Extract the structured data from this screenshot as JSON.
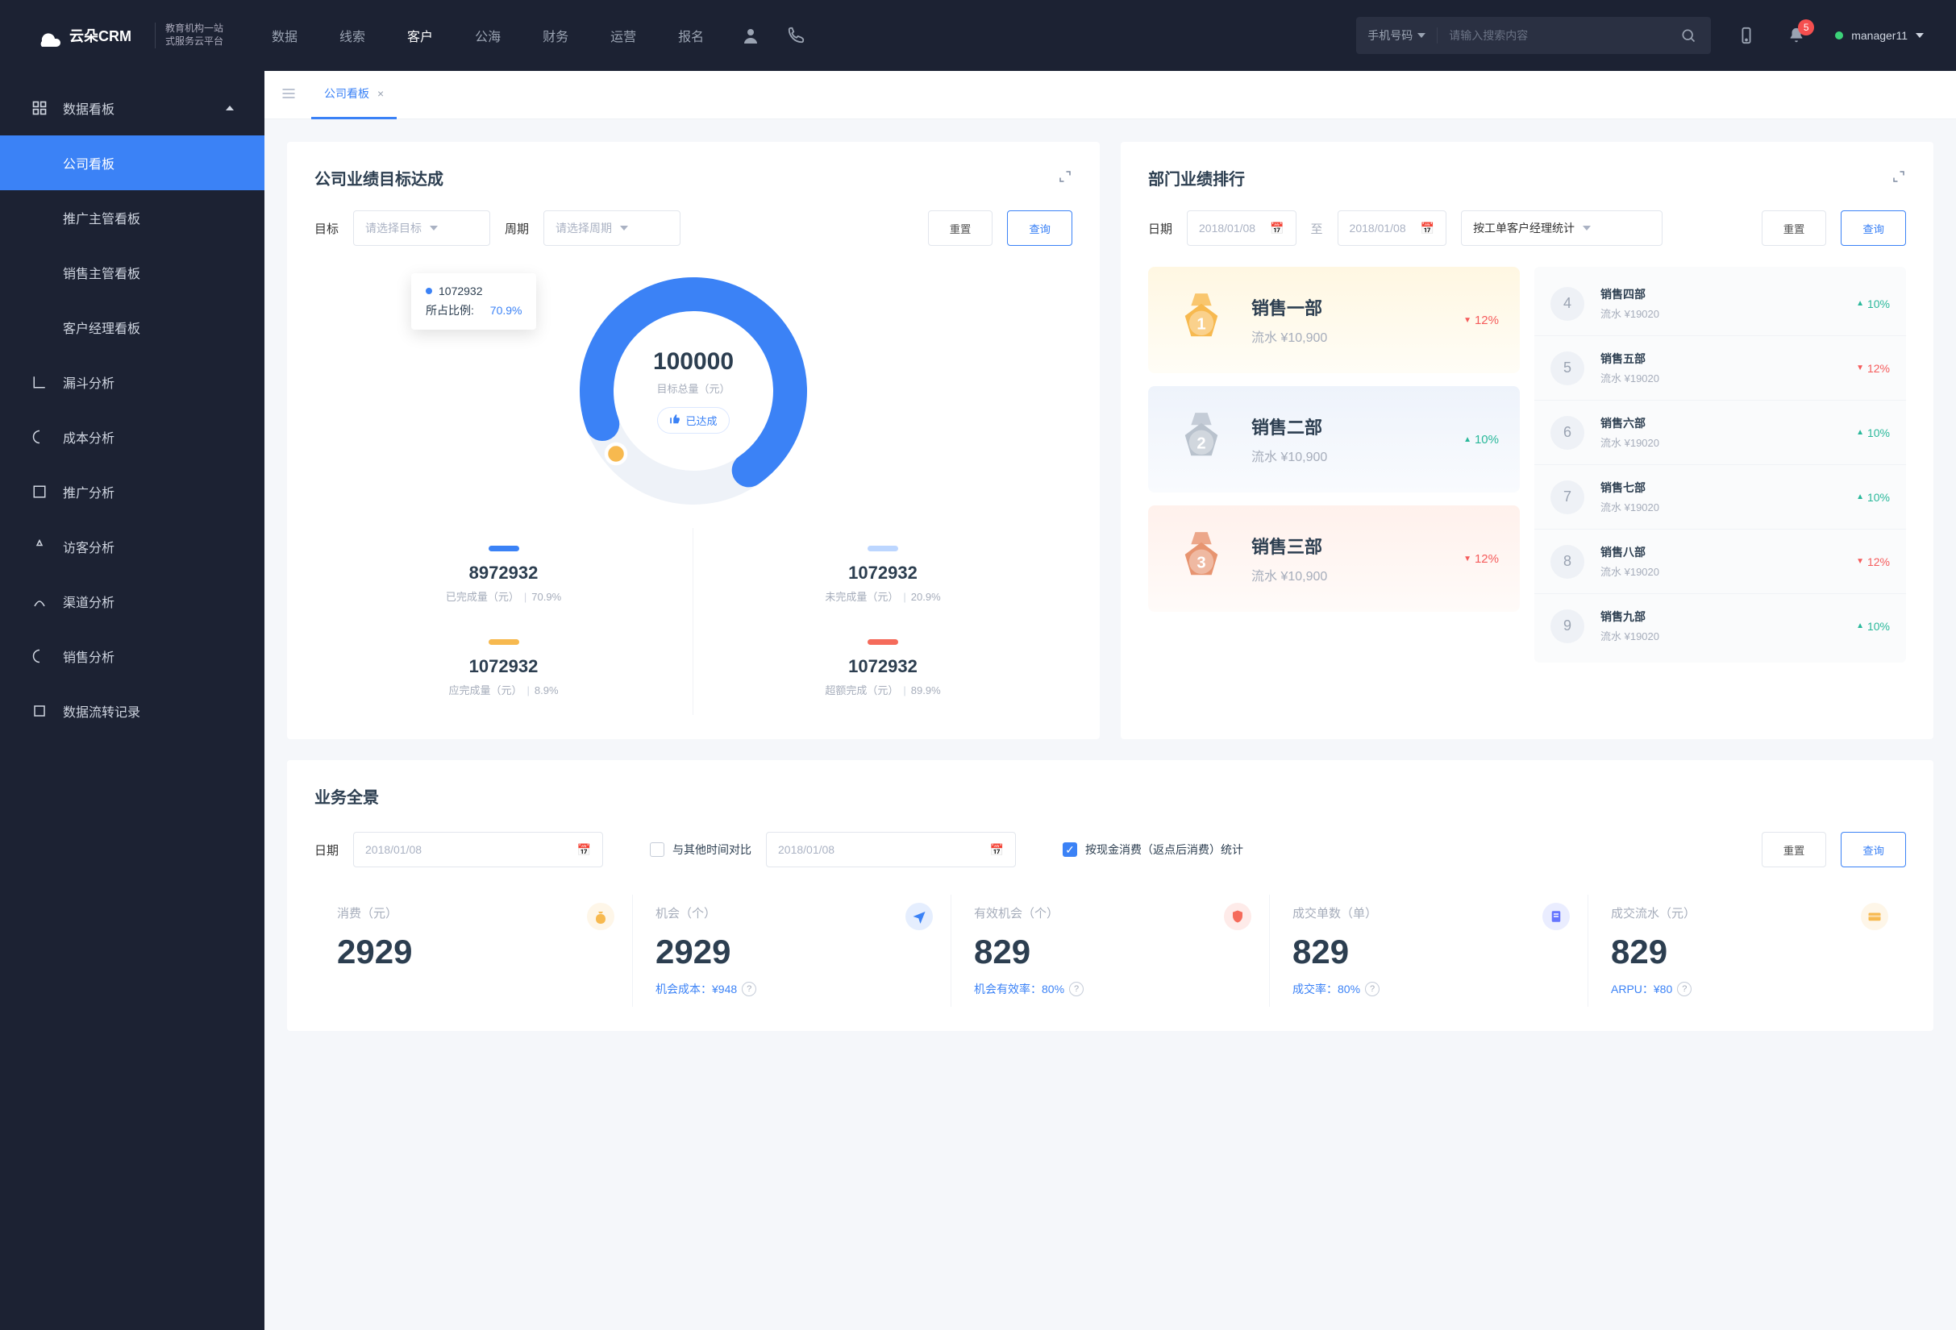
{
  "brand": {
    "name": "云朵CRM",
    "sub1": "教育机构一站",
    "sub2": "式服务云平台"
  },
  "topnav": [
    "数据",
    "线索",
    "客户",
    "公海",
    "财务",
    "运营",
    "报名"
  ],
  "topnav_active": 2,
  "search": {
    "category": "手机号码",
    "placeholder": "请输入搜索内容"
  },
  "notif_count": "5",
  "user": {
    "name": "manager11"
  },
  "sidebar": {
    "group": "数据看板",
    "subs": [
      "公司看板",
      "推广主管看板",
      "销售主管看板",
      "客户经理看板"
    ],
    "active_sub": 0,
    "items": [
      "漏斗分析",
      "成本分析",
      "推广分析",
      "访客分析",
      "渠道分析",
      "销售分析",
      "数据流转记录"
    ]
  },
  "tab": {
    "label": "公司看板"
  },
  "card1": {
    "title": "公司业绩目标达成",
    "target_lbl": "目标",
    "target_ph": "请选择目标",
    "period_lbl": "周期",
    "period_ph": "请选择周期",
    "reset": "重置",
    "query": "查询",
    "tooltip_value": "1072932",
    "tooltip_ratio_lbl": "所占比例:",
    "tooltip_ratio": "70.9%",
    "center_value": "100000",
    "center_label": "目标总量（元）",
    "tag": "已达成",
    "stats": [
      {
        "bar": "#3b82f6",
        "value": "8972932",
        "label": "已完成量（元）",
        "pct": "70.9%"
      },
      {
        "bar": "#bcd6ff",
        "value": "1072932",
        "label": "未完成量（元）",
        "pct": "20.9%"
      },
      {
        "bar": "#f7b94f",
        "value": "1072932",
        "label": "应完成量（元）",
        "pct": "8.9%"
      },
      {
        "bar": "#f56b5b",
        "value": "1072932",
        "label": "超额完成（元）",
        "pct": "89.9%"
      }
    ]
  },
  "chart_data": {
    "type": "pie",
    "title": "公司业绩目标达成",
    "center": {
      "value": 100000,
      "label": "目标总量（元）",
      "status": "已达成"
    },
    "series": [
      {
        "name": "已完成量（元）",
        "value": 8972932,
        "pct": 70.9,
        "color": "#3b82f6"
      },
      {
        "name": "未完成量（元）",
        "value": 1072932,
        "pct": 20.9,
        "color": "#bcd6ff"
      },
      {
        "name": "应完成量（元）",
        "value": 1072932,
        "pct": 8.9,
        "color": "#f7b94f"
      },
      {
        "name": "超额完成（元）",
        "value": 1072932,
        "pct": 89.9,
        "color": "#f56b5b"
      }
    ]
  },
  "card2": {
    "title": "部门业绩排行",
    "date_lbl": "日期",
    "date1": "2018/01/08",
    "to": "至",
    "date2": "2018/01/08",
    "mode": "按工单客户经理统计",
    "reset": "重置",
    "query": "查询",
    "top": [
      {
        "rank": "1",
        "name": "销售一部",
        "amt": "流水 ¥10,900",
        "delta": "12%",
        "dir": "dn"
      },
      {
        "rank": "2",
        "name": "销售二部",
        "amt": "流水 ¥10,900",
        "delta": "10%",
        "dir": "up"
      },
      {
        "rank": "3",
        "name": "销售三部",
        "amt": "流水 ¥10,900",
        "delta": "12%",
        "dir": "dn"
      }
    ],
    "rest": [
      {
        "rank": "4",
        "name": "销售四部",
        "amt": "流水 ¥19020",
        "delta": "10%",
        "dir": "up"
      },
      {
        "rank": "5",
        "name": "销售五部",
        "amt": "流水 ¥19020",
        "delta": "12%",
        "dir": "dn"
      },
      {
        "rank": "6",
        "name": "销售六部",
        "amt": "流水 ¥19020",
        "delta": "10%",
        "dir": "up"
      },
      {
        "rank": "7",
        "name": "销售七部",
        "amt": "流水 ¥19020",
        "delta": "10%",
        "dir": "up"
      },
      {
        "rank": "8",
        "name": "销售八部",
        "amt": "流水 ¥19020",
        "delta": "12%",
        "dir": "dn"
      },
      {
        "rank": "9",
        "name": "销售九部",
        "amt": "流水 ¥19020",
        "delta": "10%",
        "dir": "up"
      }
    ]
  },
  "card3": {
    "title": "业务全景",
    "date_lbl": "日期",
    "date1": "2018/01/08",
    "cmp": "与其他时间对比",
    "date2": "2018/01/08",
    "opt": "按现金消费（返点后消费）统计",
    "reset": "重置",
    "query": "查询",
    "kpis": [
      {
        "label": "消费（元）",
        "value": "2929",
        "sub": "",
        "icon": "money-bag-icon",
        "color": "#f7b94f"
      },
      {
        "label": "机会（个）",
        "value": "2929",
        "sub": "机会成本：¥948",
        "icon": "send-icon",
        "color": "#3b82f6"
      },
      {
        "label": "有效机会（个）",
        "value": "829",
        "sub": "机会有效率：80%",
        "icon": "shield-icon",
        "color": "#f56b5b"
      },
      {
        "label": "成交单数（单）",
        "value": "829",
        "sub": "成交率：80%",
        "icon": "doc-icon",
        "color": "#6575ff"
      },
      {
        "label": "成交流水（元）",
        "value": "829",
        "sub": "ARPU：¥80",
        "icon": "card-icon",
        "color": "#f7b94f"
      }
    ]
  }
}
